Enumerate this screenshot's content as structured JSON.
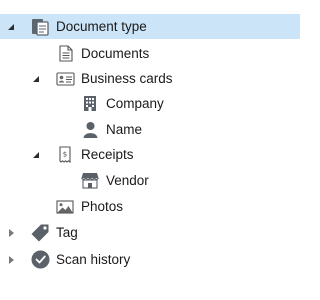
{
  "tree": {
    "document_type": {
      "label": "Document type",
      "icon": "document-type-icon",
      "expanded": true,
      "selected": true
    },
    "documents": {
      "label": "Documents",
      "icon": "document-icon"
    },
    "business_cards": {
      "label": "Business cards",
      "icon": "business-card-icon",
      "expanded": true
    },
    "company": {
      "label": "Company",
      "icon": "building-icon"
    },
    "name": {
      "label": "Name",
      "icon": "person-icon"
    },
    "receipts": {
      "label": "Receipts",
      "icon": "receipt-icon",
      "expanded": true
    },
    "vendor": {
      "label": "Vendor",
      "icon": "storefront-icon"
    },
    "photos": {
      "label": "Photos",
      "icon": "photo-icon"
    },
    "tag": {
      "label": "Tag",
      "icon": "tag-icon",
      "expanded": false
    },
    "scan_history": {
      "label": "Scan history",
      "icon": "clock-icon",
      "expanded": false
    }
  },
  "colors": {
    "selection": "#cce4f7",
    "icon_dark": "#4a5560",
    "icon_light": "#8a939c"
  }
}
